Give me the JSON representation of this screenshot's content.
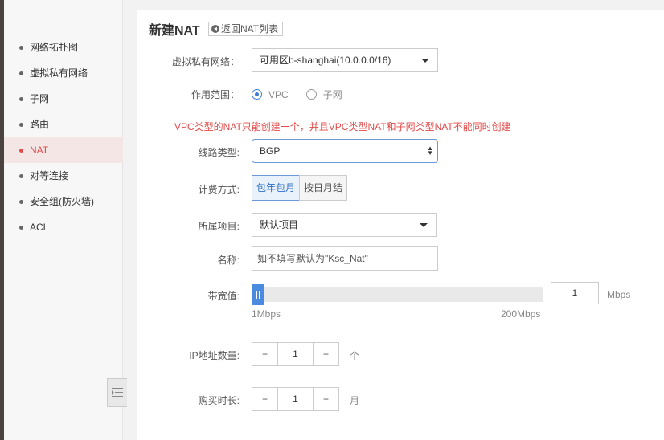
{
  "sidebar": {
    "items": [
      {
        "label": "网络拓扑图"
      },
      {
        "label": "虚拟私有网络"
      },
      {
        "label": "子网"
      },
      {
        "label": "路由"
      },
      {
        "label": "NAT",
        "active": true
      },
      {
        "label": "对等连接"
      },
      {
        "label": "安全组(防火墙)"
      },
      {
        "label": "ACL"
      }
    ],
    "collapse_icon": "collapse-menu-icon"
  },
  "header": {
    "title": "新建NAT",
    "back_label": "返回NAT列表",
    "back_icon": "arrow-circle-left-icon"
  },
  "form": {
    "vpc_label": "虚拟私有网络：",
    "vpc_value": "可用区b-shanghai(10.0.0.0/16)",
    "scope_label": "作用范围：",
    "scope_options": [
      "VPC",
      "子网"
    ],
    "scope_selected": "VPC",
    "warning": "VPC类型的NAT只能创建一个，并且VPC类型NAT和子网类型NAT不能同时创建",
    "line_label": "线路类型:",
    "line_value": "BGP",
    "billing_label": "计费方式:",
    "billing_options": [
      "包年包月",
      "按日月结"
    ],
    "billing_selected": "包年包月",
    "project_label": "所属项目:",
    "project_value": "默认项目",
    "name_label": "名称:",
    "name_placeholder": "如不填写默认为\"Ksc_Nat\"",
    "bandwidth_label": "带宽值:",
    "bandwidth_min": "1Mbps",
    "bandwidth_max": "200Mbps",
    "bandwidth_value": "1",
    "bandwidth_unit": "Mbps",
    "ip_count_label": "IP地址数量:",
    "ip_count_value": "1",
    "ip_count_unit": "个",
    "duration_label": "购买时长:",
    "duration_value": "1",
    "duration_unit": "月",
    "stepper_minus": "−",
    "stepper_plus": "+"
  },
  "colors": {
    "accent": "#3d7bd6",
    "active_nav": "#e24a4a",
    "warning": "#e24a4a"
  }
}
